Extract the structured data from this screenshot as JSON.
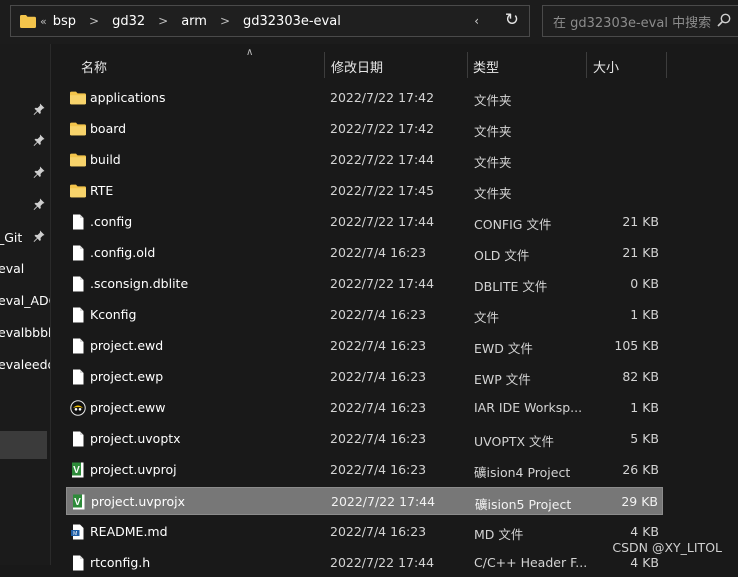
{
  "breadcrumb": {
    "lead": "«",
    "items": [
      "bsp",
      "gd32",
      "arm",
      "gd32303e-eval"
    ],
    "separator": ">"
  },
  "search": {
    "placeholder": "在 gd32303e-eval 中搜索"
  },
  "nav": {
    "items": [
      {
        "label": "",
        "pinned": true
      },
      {
        "label": "",
        "pinned": true
      },
      {
        "label": "",
        "pinned": true
      },
      {
        "label": "",
        "pinned": true
      },
      {
        "label": "_Git",
        "pinned": true
      },
      {
        "label": "eval",
        "pinned": false
      },
      {
        "label": "eval_ADC",
        "pinned": false
      },
      {
        "label": "evalbbbb",
        "pinned": false
      },
      {
        "label": "evaleedd",
        "pinned": false
      }
    ]
  },
  "columns": {
    "name": "名称",
    "date": "修改日期",
    "type": "类型",
    "size": "大小"
  },
  "files": [
    {
      "name": "applications",
      "date": "2022/7/22 17:42",
      "type": "文件夹",
      "size": "",
      "icon": "folder-icon",
      "selected": false
    },
    {
      "name": "board",
      "date": "2022/7/22 17:42",
      "type": "文件夹",
      "size": "",
      "icon": "folder-icon",
      "selected": false
    },
    {
      "name": "build",
      "date": "2022/7/22 17:44",
      "type": "文件夹",
      "size": "",
      "icon": "folder-icon",
      "selected": false
    },
    {
      "name": "RTE",
      "date": "2022/7/22 17:45",
      "type": "文件夹",
      "size": "",
      "icon": "folder-icon",
      "selected": false
    },
    {
      "name": ".config",
      "date": "2022/7/22 17:44",
      "type": "CONFIG 文件",
      "size": "21 KB",
      "icon": "file-icon",
      "selected": false
    },
    {
      "name": ".config.old",
      "date": "2022/7/4 16:23",
      "type": "OLD 文件",
      "size": "21 KB",
      "icon": "file-icon",
      "selected": false
    },
    {
      "name": ".sconsign.dblite",
      "date": "2022/7/22 17:44",
      "type": "DBLITE 文件",
      "size": "0 KB",
      "icon": "file-icon",
      "selected": false
    },
    {
      "name": "Kconfig",
      "date": "2022/7/4 16:23",
      "type": "文件",
      "size": "1 KB",
      "icon": "file-icon",
      "selected": false
    },
    {
      "name": "project.ewd",
      "date": "2022/7/4 16:23",
      "type": "EWD 文件",
      "size": "105 KB",
      "icon": "file-icon",
      "selected": false
    },
    {
      "name": "project.ewp",
      "date": "2022/7/4 16:23",
      "type": "EWP 文件",
      "size": "82 KB",
      "icon": "file-icon",
      "selected": false
    },
    {
      "name": "project.eww",
      "date": "2022/7/4 16:23",
      "type": "IAR IDE Worksp...",
      "size": "1 KB",
      "icon": "iar-workspace-icon",
      "selected": false
    },
    {
      "name": "project.uvoptx",
      "date": "2022/7/4 16:23",
      "type": "UVOPTX 文件",
      "size": "5 KB",
      "icon": "file-icon",
      "selected": false
    },
    {
      "name": "project.uvproj",
      "date": "2022/7/4 16:23",
      "type": "礦ision4 Project",
      "size": "26 KB",
      "icon": "keil-project-icon",
      "selected": false
    },
    {
      "name": "project.uvprojx",
      "date": "2022/7/22 17:44",
      "type": "礦ision5 Project",
      "size": "29 KB",
      "icon": "keil-project-icon",
      "selected": true
    },
    {
      "name": "README.md",
      "date": "2022/7/4 16:23",
      "type": "MD 文件",
      "size": "4 KB",
      "icon": "markdown-file-icon",
      "selected": false
    },
    {
      "name": "rtconfig.h",
      "date": "2022/7/22 17:44",
      "type": "C/C++ Header F...",
      "size": "4 KB",
      "icon": "file-icon",
      "selected": false
    }
  ],
  "watermark": "CSDN @XY_LITOL",
  "colors": {
    "background": "#191919",
    "folder": "#f3c44b",
    "selection": "#777777",
    "keil_green": "#2e8b3a"
  }
}
